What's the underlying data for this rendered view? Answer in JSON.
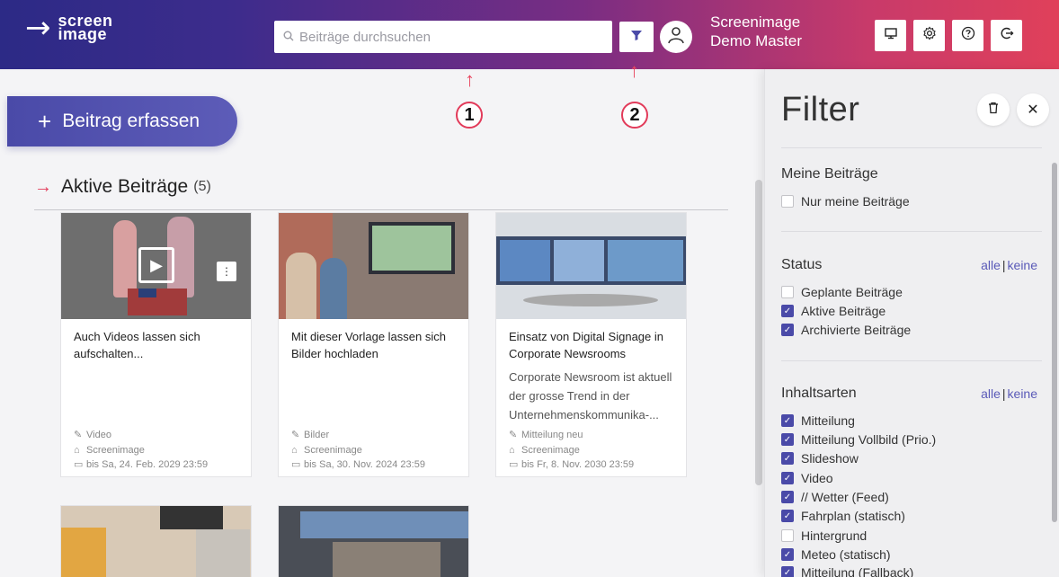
{
  "header": {
    "logo_line1": "screen",
    "logo_line2": "image",
    "search_placeholder": "Beiträge durchsuchen",
    "user_line1": "Screenimage",
    "user_line2": "Demo Master",
    "icons": [
      "monitor-icon",
      "gear-icon",
      "help-icon",
      "logout-icon"
    ]
  },
  "annotations": {
    "one": "1",
    "two": "2"
  },
  "add_button": {
    "label": "Beitrag erfassen"
  },
  "section": {
    "title": "Aktive Beiträge",
    "count": "(5)"
  },
  "cards": [
    {
      "title": "Auch Videos lassen sich aufschalten...",
      "desc": "",
      "type": "Video",
      "source": "Screenimage",
      "until": "bis Sa, 24. Feb. 2029 23:59"
    },
    {
      "title": "Mit dieser Vorlage lassen sich Bilder hochladen",
      "desc": "",
      "type": "Bilder",
      "source": "Screenimage",
      "until": "bis Sa, 30. Nov. 2024 23:59"
    },
    {
      "title": "Einsatz von Digital Signage in Corporate Newsrooms",
      "desc": "Corporate Newsroom ist ak­tuell der grosse Trend in der Unternehmenskommunika-...",
      "type": "Mitteilung neu",
      "source": "Screenimage",
      "until": "bis Fr, 8. Nov. 2030 23:59"
    }
  ],
  "filter": {
    "title": "Filter",
    "meine": {
      "title": "Meine Beiträge",
      "items": [
        {
          "label": "Nur meine Beiträge",
          "checked": false
        }
      ]
    },
    "status": {
      "title": "Status",
      "all": "alle",
      "sep": "|",
      "none": "keine",
      "items": [
        {
          "label": "Geplante Beiträge",
          "checked": false
        },
        {
          "label": "Aktive Beiträge",
          "checked": true
        },
        {
          "label": "Archivierte Beiträge",
          "checked": true
        }
      ]
    },
    "inhalt": {
      "title": "Inhaltsarten",
      "all": "alle",
      "sep": "|",
      "none": "keine",
      "items": [
        {
          "label": "Mitteilung",
          "checked": true
        },
        {
          "label": "Mitteilung Vollbild (Prio.)",
          "checked": true
        },
        {
          "label": "Slideshow",
          "checked": true
        },
        {
          "label": "Video",
          "checked": true
        },
        {
          "label": "// Wetter (Feed)",
          "checked": true
        },
        {
          "label": "Fahrplan (statisch)",
          "checked": true
        },
        {
          "label": "Hintergrund",
          "checked": false
        },
        {
          "label": "Meteo (statisch)",
          "checked": true
        },
        {
          "label": "Mitteilung (Fallback)",
          "checked": true
        }
      ]
    }
  }
}
